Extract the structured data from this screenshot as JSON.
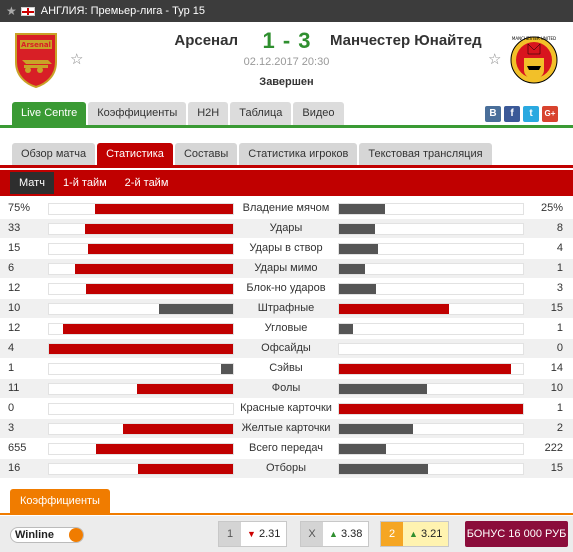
{
  "header": {
    "country": "АНГЛИЯ",
    "league_title": "АНГЛИЯ: Премьер-лига - Тур 15"
  },
  "match": {
    "home": "Арсенал",
    "away": "Манчестер Юнайтед",
    "score": "1 - 3",
    "date": "02.12.2017 20:30",
    "status": "Завершен",
    "home_logo_text": "Arsenal",
    "away_logo_text": "MANCHESTER UNITED"
  },
  "tabs": [
    "Live Centre",
    "Коэффициенты",
    "H2H",
    "Таблица",
    "Видео"
  ],
  "share": [
    {
      "icon": "vk-icon",
      "label": "В",
      "color": "#4a6f9a"
    },
    {
      "icon": "facebook-icon",
      "label": "f",
      "color": "#3b5998"
    },
    {
      "icon": "twitter-icon",
      "label": "t",
      "color": "#2aa9e0"
    },
    {
      "icon": "google-plus-icon",
      "label": "G+",
      "color": "#d8432e"
    }
  ],
  "subtabs": [
    "Обзор матча",
    "Статистика",
    "Составы",
    "Статистика игроков",
    "Текстовая трансляция"
  ],
  "periods": [
    "Матч",
    "1-й тайм",
    "2-й тайм"
  ],
  "stats": [
    {
      "label": "Владение мячом",
      "home": "75%",
      "away": "25%",
      "h": 75,
      "a": 25
    },
    {
      "label": "Удары",
      "home": "33",
      "away": "8",
      "h": 33,
      "a": 8
    },
    {
      "label": "Удары в створ",
      "home": "15",
      "away": "4",
      "h": 15,
      "a": 4
    },
    {
      "label": "Удары мимо",
      "home": "6",
      "away": "1",
      "h": 6,
      "a": 1
    },
    {
      "label": "Блок-но ударов",
      "home": "12",
      "away": "3",
      "h": 12,
      "a": 3
    },
    {
      "label": "Штрафные",
      "home": "10",
      "away": "15",
      "h": 10,
      "a": 15
    },
    {
      "label": "Угловые",
      "home": "12",
      "away": "1",
      "h": 12,
      "a": 1
    },
    {
      "label": "Офсайды",
      "home": "4",
      "away": "0",
      "h": 4,
      "a": 0
    },
    {
      "label": "Сэйвы",
      "home": "1",
      "away": "14",
      "h": 1,
      "a": 14
    },
    {
      "label": "Фолы",
      "home": "11",
      "away": "10",
      "h": 11,
      "a": 10
    },
    {
      "label": "Красные карточки",
      "home": "0",
      "away": "1",
      "h": 0,
      "a": 1
    },
    {
      "label": "Желтые карточки",
      "home": "3",
      "away": "2",
      "h": 3,
      "a": 2
    },
    {
      "label": "Всего передач",
      "home": "655",
      "away": "222",
      "h": 655,
      "a": 222
    },
    {
      "label": "Отборы",
      "home": "16",
      "away": "15",
      "h": 16,
      "a": 15
    }
  ],
  "odds": {
    "tab_label": "Коэффициенты",
    "bookmaker": "Winline",
    "items": [
      {
        "key": "1",
        "value": "2.31",
        "trend": "down",
        "arrow": "▼"
      },
      {
        "key": "X",
        "value": "3.38",
        "trend": "up",
        "arrow": "▲"
      },
      {
        "key": "2",
        "value": "3.21",
        "trend": "up",
        "arrow": "▲"
      }
    ],
    "bonus": "БОНУС 16 000 РУБ"
  },
  "colors": {
    "home_bar": "#c00000",
    "away_bar": "#555555",
    "accent_green": "#3a9a34",
    "accent_red": "#c00000"
  }
}
